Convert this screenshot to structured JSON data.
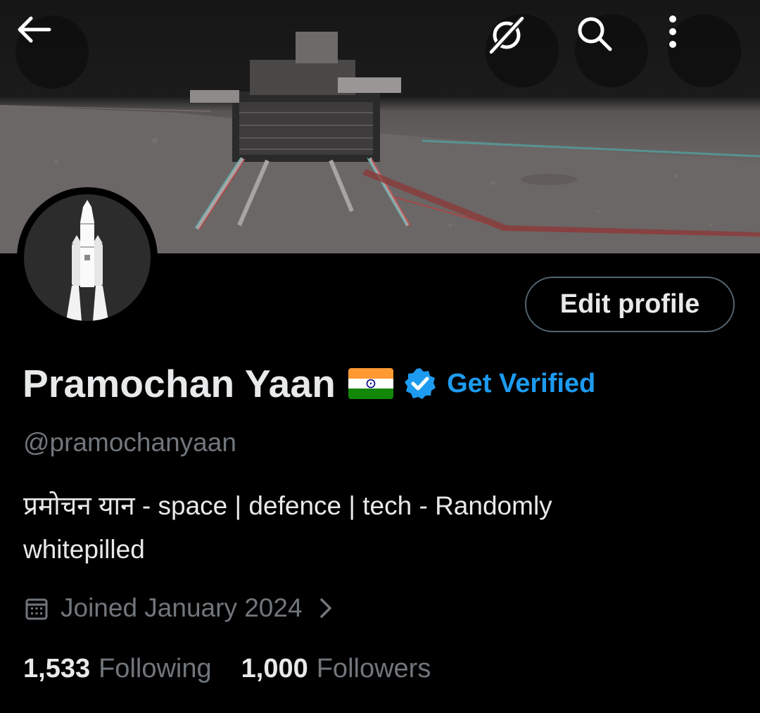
{
  "header": {
    "back_icon": "arrow-left-icon",
    "grok_icon": "grok-icon",
    "search_icon": "search-icon",
    "more_icon": "more-vertical-icon"
  },
  "profile": {
    "name": "Pramochan Yaan",
    "flag": "🇮🇳",
    "verified_badge_color": "#1d9bf0",
    "get_verified_label": "Get Verified",
    "handle": "@pramochanyaan",
    "bio": "प्रमोचन यान - space | defence | tech - Randomly whitepilled",
    "joined": "Joined January 2024",
    "edit_profile_label": "Edit profile"
  },
  "stats": {
    "following_count": "1,533",
    "following_label": "Following",
    "followers_count": "1,000",
    "followers_label": "Followers"
  },
  "colors": {
    "background": "#000000",
    "text_primary": "#e7e9ea",
    "text_secondary": "#71767b",
    "accent": "#1d9bf0",
    "border": "#536471"
  }
}
